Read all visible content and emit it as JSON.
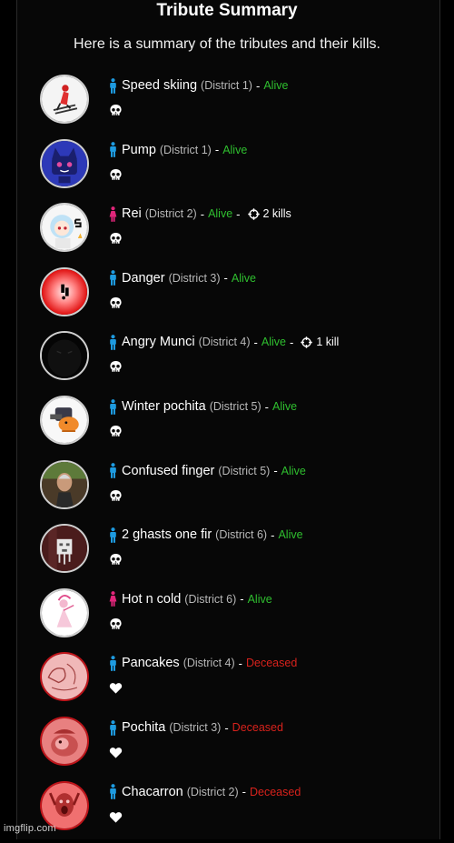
{
  "page": {
    "title": "Tribute Summary",
    "subtitle": "Here is a summary of the tributes and their kills."
  },
  "tributes": [
    {
      "name": "Speed skiing",
      "district": "(District 1)",
      "status": "Alive",
      "kills": "",
      "gender": "male",
      "status_icon": "skull-icon",
      "avatar": "skier"
    },
    {
      "name": "Pump",
      "district": "(District 1)",
      "status": "Alive",
      "kills": "",
      "gender": "male",
      "status_icon": "skull-icon",
      "avatar": "blue-cat"
    },
    {
      "name": "Rei",
      "district": "(District 2)",
      "status": "Alive",
      "kills": "2 kills",
      "gender": "female",
      "status_icon": "skull-icon",
      "avatar": "rei"
    },
    {
      "name": "Danger",
      "district": "(District 3)",
      "status": "Alive",
      "kills": "",
      "gender": "male",
      "status_icon": "skull-icon",
      "avatar": "danger"
    },
    {
      "name": "Angry Munci",
      "district": "(District 4)",
      "status": "Alive",
      "kills": "1 kill",
      "gender": "male",
      "status_icon": "skull-icon",
      "avatar": "munci"
    },
    {
      "name": "Winter pochita",
      "district": "(District 5)",
      "status": "Alive",
      "kills": "",
      "gender": "male",
      "status_icon": "skull-icon",
      "avatar": "pochita-winter"
    },
    {
      "name": "Confused finger",
      "district": "(District 5)",
      "status": "Alive",
      "kills": "",
      "gender": "male",
      "status_icon": "skull-icon",
      "avatar": "man"
    },
    {
      "name": "2 ghasts one fir",
      "district": "(District 6)",
      "status": "Alive",
      "kills": "",
      "gender": "male",
      "status_icon": "skull-icon",
      "avatar": "ghast"
    },
    {
      "name": "Hot n cold",
      "district": "(District 6)",
      "status": "Alive",
      "kills": "",
      "gender": "female",
      "status_icon": "skull-icon",
      "avatar": "dancer"
    },
    {
      "name": "Pancakes",
      "district": "(District 4)",
      "status": "Deceased",
      "kills": "",
      "gender": "male",
      "status_icon": "heart-icon",
      "avatar": "pancakes"
    },
    {
      "name": "Pochita",
      "district": "(District 3)",
      "status": "Deceased",
      "kills": "",
      "gender": "male",
      "status_icon": "heart-icon",
      "avatar": "pochita"
    },
    {
      "name": "Chacarron",
      "district": "(District 2)",
      "status": "Deceased",
      "kills": "",
      "gender": "male",
      "status_icon": "heart-icon",
      "avatar": "chacarron"
    }
  ],
  "separator": "-",
  "colors": {
    "alive": "#2fbf2f",
    "deceased": "#d8221c",
    "male": "#1e9be0",
    "female": "#e0267a"
  },
  "watermark": "imgflip.com"
}
